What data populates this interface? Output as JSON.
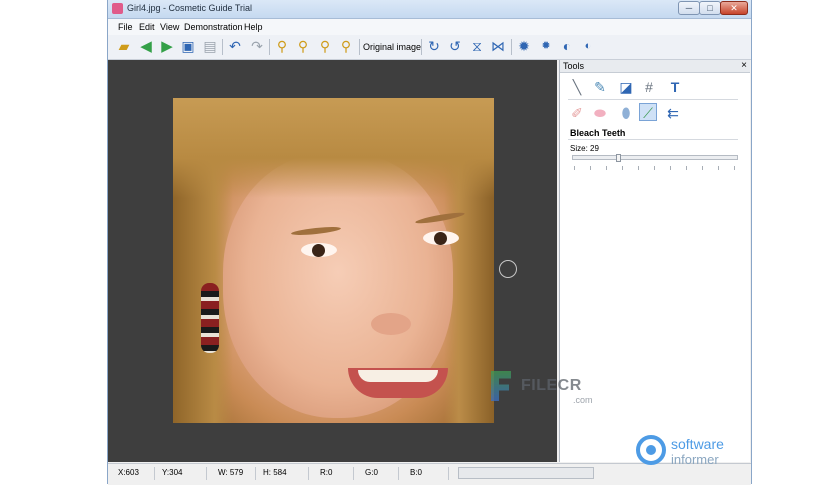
{
  "window": {
    "title": "Girl4.jpg - Cosmetic Guide Trial",
    "buttons": {
      "minimize": "─",
      "maximize": "□",
      "close": "✕"
    }
  },
  "menu": [
    "File",
    "Edit",
    "View",
    "Demonstration",
    "Help"
  ],
  "toolbar": {
    "original_image_label": "Original image",
    "icons": [
      "open-folder",
      "back-arrow",
      "forward-arrow",
      "save",
      "print",
      "undo",
      "redo",
      "zoom-in",
      "zoom-out",
      "zoom-fit",
      "zoom-actual",
      "rotate-right",
      "rotate-left",
      "flip-vertical",
      "flip-horizontal",
      "brightness",
      "brightness-small",
      "contrast",
      "contrast-small"
    ]
  },
  "tools_panel": {
    "title": "Tools",
    "close": "×",
    "tool_icons_row1": [
      "pencil",
      "pen",
      "crop",
      "grid",
      "text"
    ],
    "tool_icons_row2": [
      "eraser",
      "blush",
      "bottle",
      "brush",
      "arrow-back"
    ],
    "selected_tool_label": "Bleach Teeth",
    "size_label": "Size: 29",
    "size_value": 29
  },
  "status": {
    "x": "X:603",
    "y": "Y:304",
    "w": "W: 579",
    "h": "H: 584",
    "r": "R:0",
    "g": "G:0",
    "b": "B:0"
  },
  "watermarks": {
    "filecr": "FILECR",
    "filecr_sub": ".com",
    "software_informer_1": "software",
    "software_informer_2": "informer"
  }
}
